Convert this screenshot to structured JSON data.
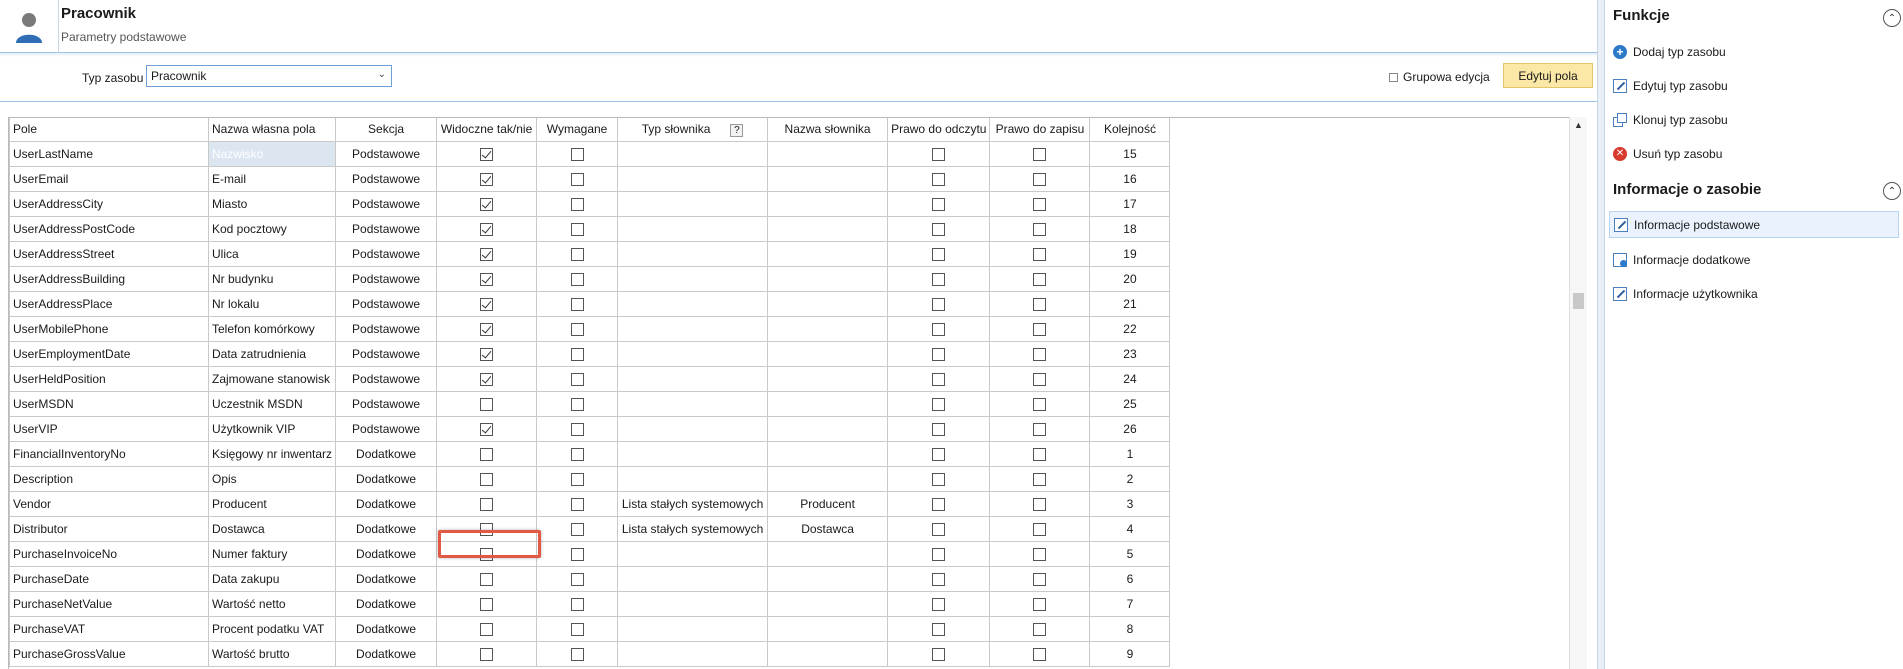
{
  "header": {
    "title": "Pracownik",
    "subtitle": "Parametry podstawowe",
    "avatar_icon": "user-avatar-icon"
  },
  "toolbar": {
    "type_label": "Typ zasobu",
    "type_value": "Pracownik",
    "group_edit_label": "Grupowa edycja",
    "edit_fields_label": "Edytuj pola"
  },
  "grid": {
    "columns": [
      "Pole",
      "Nazwa własna pola",
      "Sekcja",
      "Widoczne tak/nie",
      "Wymagane",
      "Typ słownika",
      "Nazwa słownika",
      "Prawo do odczytu",
      "Prawo do zapisu",
      "Kolejność"
    ],
    "help_glyph": "?",
    "rows": [
      {
        "pole": "UserLastName",
        "nazwa": "Nazwisko",
        "sekcja": "Podstawowe",
        "widoczne": true,
        "wymagane": false,
        "typ": "",
        "slownik": "",
        "odczyt": false,
        "zapis": false,
        "kolejnosc": "15",
        "dim": true
      },
      {
        "pole": "UserEmail",
        "nazwa": "E-mail",
        "sekcja": "Podstawowe",
        "widoczne": true,
        "wymagane": false,
        "typ": "",
        "slownik": "",
        "odczyt": false,
        "zapis": false,
        "kolejnosc": "16"
      },
      {
        "pole": "UserAddressCity",
        "nazwa": "Miasto",
        "sekcja": "Podstawowe",
        "widoczne": true,
        "wymagane": false,
        "typ": "",
        "slownik": "",
        "odczyt": false,
        "zapis": false,
        "kolejnosc": "17"
      },
      {
        "pole": "UserAddressPostCode",
        "nazwa": "Kod pocztowy",
        "sekcja": "Podstawowe",
        "widoczne": true,
        "wymagane": false,
        "typ": "",
        "slownik": "",
        "odczyt": false,
        "zapis": false,
        "kolejnosc": "18"
      },
      {
        "pole": "UserAddressStreet",
        "nazwa": "Ulica",
        "sekcja": "Podstawowe",
        "widoczne": true,
        "wymagane": false,
        "typ": "",
        "slownik": "",
        "odczyt": false,
        "zapis": false,
        "kolejnosc": "19"
      },
      {
        "pole": "UserAddressBuilding",
        "nazwa": "Nr budynku",
        "sekcja": "Podstawowe",
        "widoczne": true,
        "wymagane": false,
        "typ": "",
        "slownik": "",
        "odczyt": false,
        "zapis": false,
        "kolejnosc": "20"
      },
      {
        "pole": "UserAddressPlace",
        "nazwa": "Nr lokalu",
        "sekcja": "Podstawowe",
        "widoczne": true,
        "wymagane": false,
        "typ": "",
        "slownik": "",
        "odczyt": false,
        "zapis": false,
        "kolejnosc": "21"
      },
      {
        "pole": "UserMobilePhone",
        "nazwa": "Telefon komórkowy",
        "sekcja": "Podstawowe",
        "widoczne": true,
        "wymagane": false,
        "typ": "",
        "slownik": "",
        "odczyt": false,
        "zapis": false,
        "kolejnosc": "22"
      },
      {
        "pole": "UserEmploymentDate",
        "nazwa": "Data zatrudnienia",
        "sekcja": "Podstawowe",
        "widoczne": true,
        "wymagane": false,
        "typ": "",
        "slownik": "",
        "odczyt": false,
        "zapis": false,
        "kolejnosc": "23"
      },
      {
        "pole": "UserHeldPosition",
        "nazwa": "Zajmowane stanowisk",
        "sekcja": "Podstawowe",
        "widoczne": true,
        "wymagane": false,
        "typ": "",
        "slownik": "",
        "odczyt": false,
        "zapis": false,
        "kolejnosc": "24"
      },
      {
        "pole": "UserMSDN",
        "nazwa": "Uczestnik MSDN",
        "sekcja": "Podstawowe",
        "widoczne": false,
        "wymagane": false,
        "typ": "",
        "slownik": "",
        "odczyt": false,
        "zapis": false,
        "kolejnosc": "25"
      },
      {
        "pole": "UserVIP",
        "nazwa": "Użytkownik VIP",
        "sekcja": "Podstawowe",
        "widoczne": true,
        "wymagane": false,
        "typ": "",
        "slownik": "",
        "odczyt": false,
        "zapis": false,
        "kolejnosc": "26",
        "highlight": true
      },
      {
        "pole": "FinancialInventoryNo",
        "nazwa": "Księgowy nr inwentarz",
        "sekcja": "Dodatkowe",
        "widoczne": false,
        "wymagane": false,
        "typ": "",
        "slownik": "",
        "odczyt": false,
        "zapis": false,
        "kolejnosc": "1"
      },
      {
        "pole": "Description",
        "nazwa": "Opis",
        "sekcja": "Dodatkowe",
        "widoczne": false,
        "wymagane": false,
        "typ": "",
        "slownik": "",
        "odczyt": false,
        "zapis": false,
        "kolejnosc": "2"
      },
      {
        "pole": "Vendor",
        "nazwa": "Producent",
        "sekcja": "Dodatkowe",
        "widoczne": false,
        "wymagane": false,
        "typ": "Lista stałych systemowych",
        "slownik": "Producent",
        "odczyt": false,
        "zapis": false,
        "kolejnosc": "3"
      },
      {
        "pole": "Distributor",
        "nazwa": "Dostawca",
        "sekcja": "Dodatkowe",
        "widoczne": false,
        "wymagane": false,
        "typ": "Lista stałych systemowych",
        "slownik": "Dostawca",
        "odczyt": false,
        "zapis": false,
        "kolejnosc": "4"
      },
      {
        "pole": "PurchaseInvoiceNo",
        "nazwa": "Numer faktury",
        "sekcja": "Dodatkowe",
        "widoczne": false,
        "wymagane": false,
        "typ": "",
        "slownik": "",
        "odczyt": false,
        "zapis": false,
        "kolejnosc": "5"
      },
      {
        "pole": "PurchaseDate",
        "nazwa": "Data zakupu",
        "sekcja": "Dodatkowe",
        "widoczne": false,
        "wymagane": false,
        "typ": "",
        "slownik": "",
        "odczyt": false,
        "zapis": false,
        "kolejnosc": "6"
      },
      {
        "pole": "PurchaseNetValue",
        "nazwa": "Wartość netto",
        "sekcja": "Dodatkowe",
        "widoczne": false,
        "wymagane": false,
        "typ": "",
        "slownik": "",
        "odczyt": false,
        "zapis": false,
        "kolejnosc": "7"
      },
      {
        "pole": "PurchaseVAT",
        "nazwa": "Procent podatku VAT",
        "sekcja": "Dodatkowe",
        "widoczne": false,
        "wymagane": false,
        "typ": "",
        "slownik": "",
        "odczyt": false,
        "zapis": false,
        "kolejnosc": "8"
      },
      {
        "pole": "PurchaseGrossValue",
        "nazwa": "Wartość brutto",
        "sekcja": "Dodatkowe",
        "widoczne": false,
        "wymagane": false,
        "typ": "",
        "slownik": "",
        "odczyt": false,
        "zapis": false,
        "kolejnosc": "9"
      }
    ]
  },
  "right_panel": {
    "functions": {
      "title": "Funkcje",
      "items": [
        {
          "label": "Dodaj typ zasobu",
          "icon": "add-circle-icon"
        },
        {
          "label": "Edytuj typ zasobu",
          "icon": "edit-icon"
        },
        {
          "label": "Klonuj typ zasobu",
          "icon": "clone-icon"
        },
        {
          "label": "Usuń typ zasobu",
          "icon": "delete-circle-icon"
        }
      ]
    },
    "info": {
      "title": "Informacje o zasobie",
      "items": [
        {
          "label": "Informacje podstawowe",
          "icon": "edit-icon",
          "active": true
        },
        {
          "label": "Informacje dodatkowe",
          "icon": "info-extra-icon"
        },
        {
          "label": "Informacje użytkownika",
          "icon": "edit-icon"
        }
      ]
    }
  },
  "colors": {
    "accent_border": "#9ec5e8",
    "edit_button_bg": "#fbe8a6",
    "highlight_box": "#e05a45",
    "active_item_bg": "#eaf3fd",
    "dim_cell_bg": "#dbe6f1"
  }
}
